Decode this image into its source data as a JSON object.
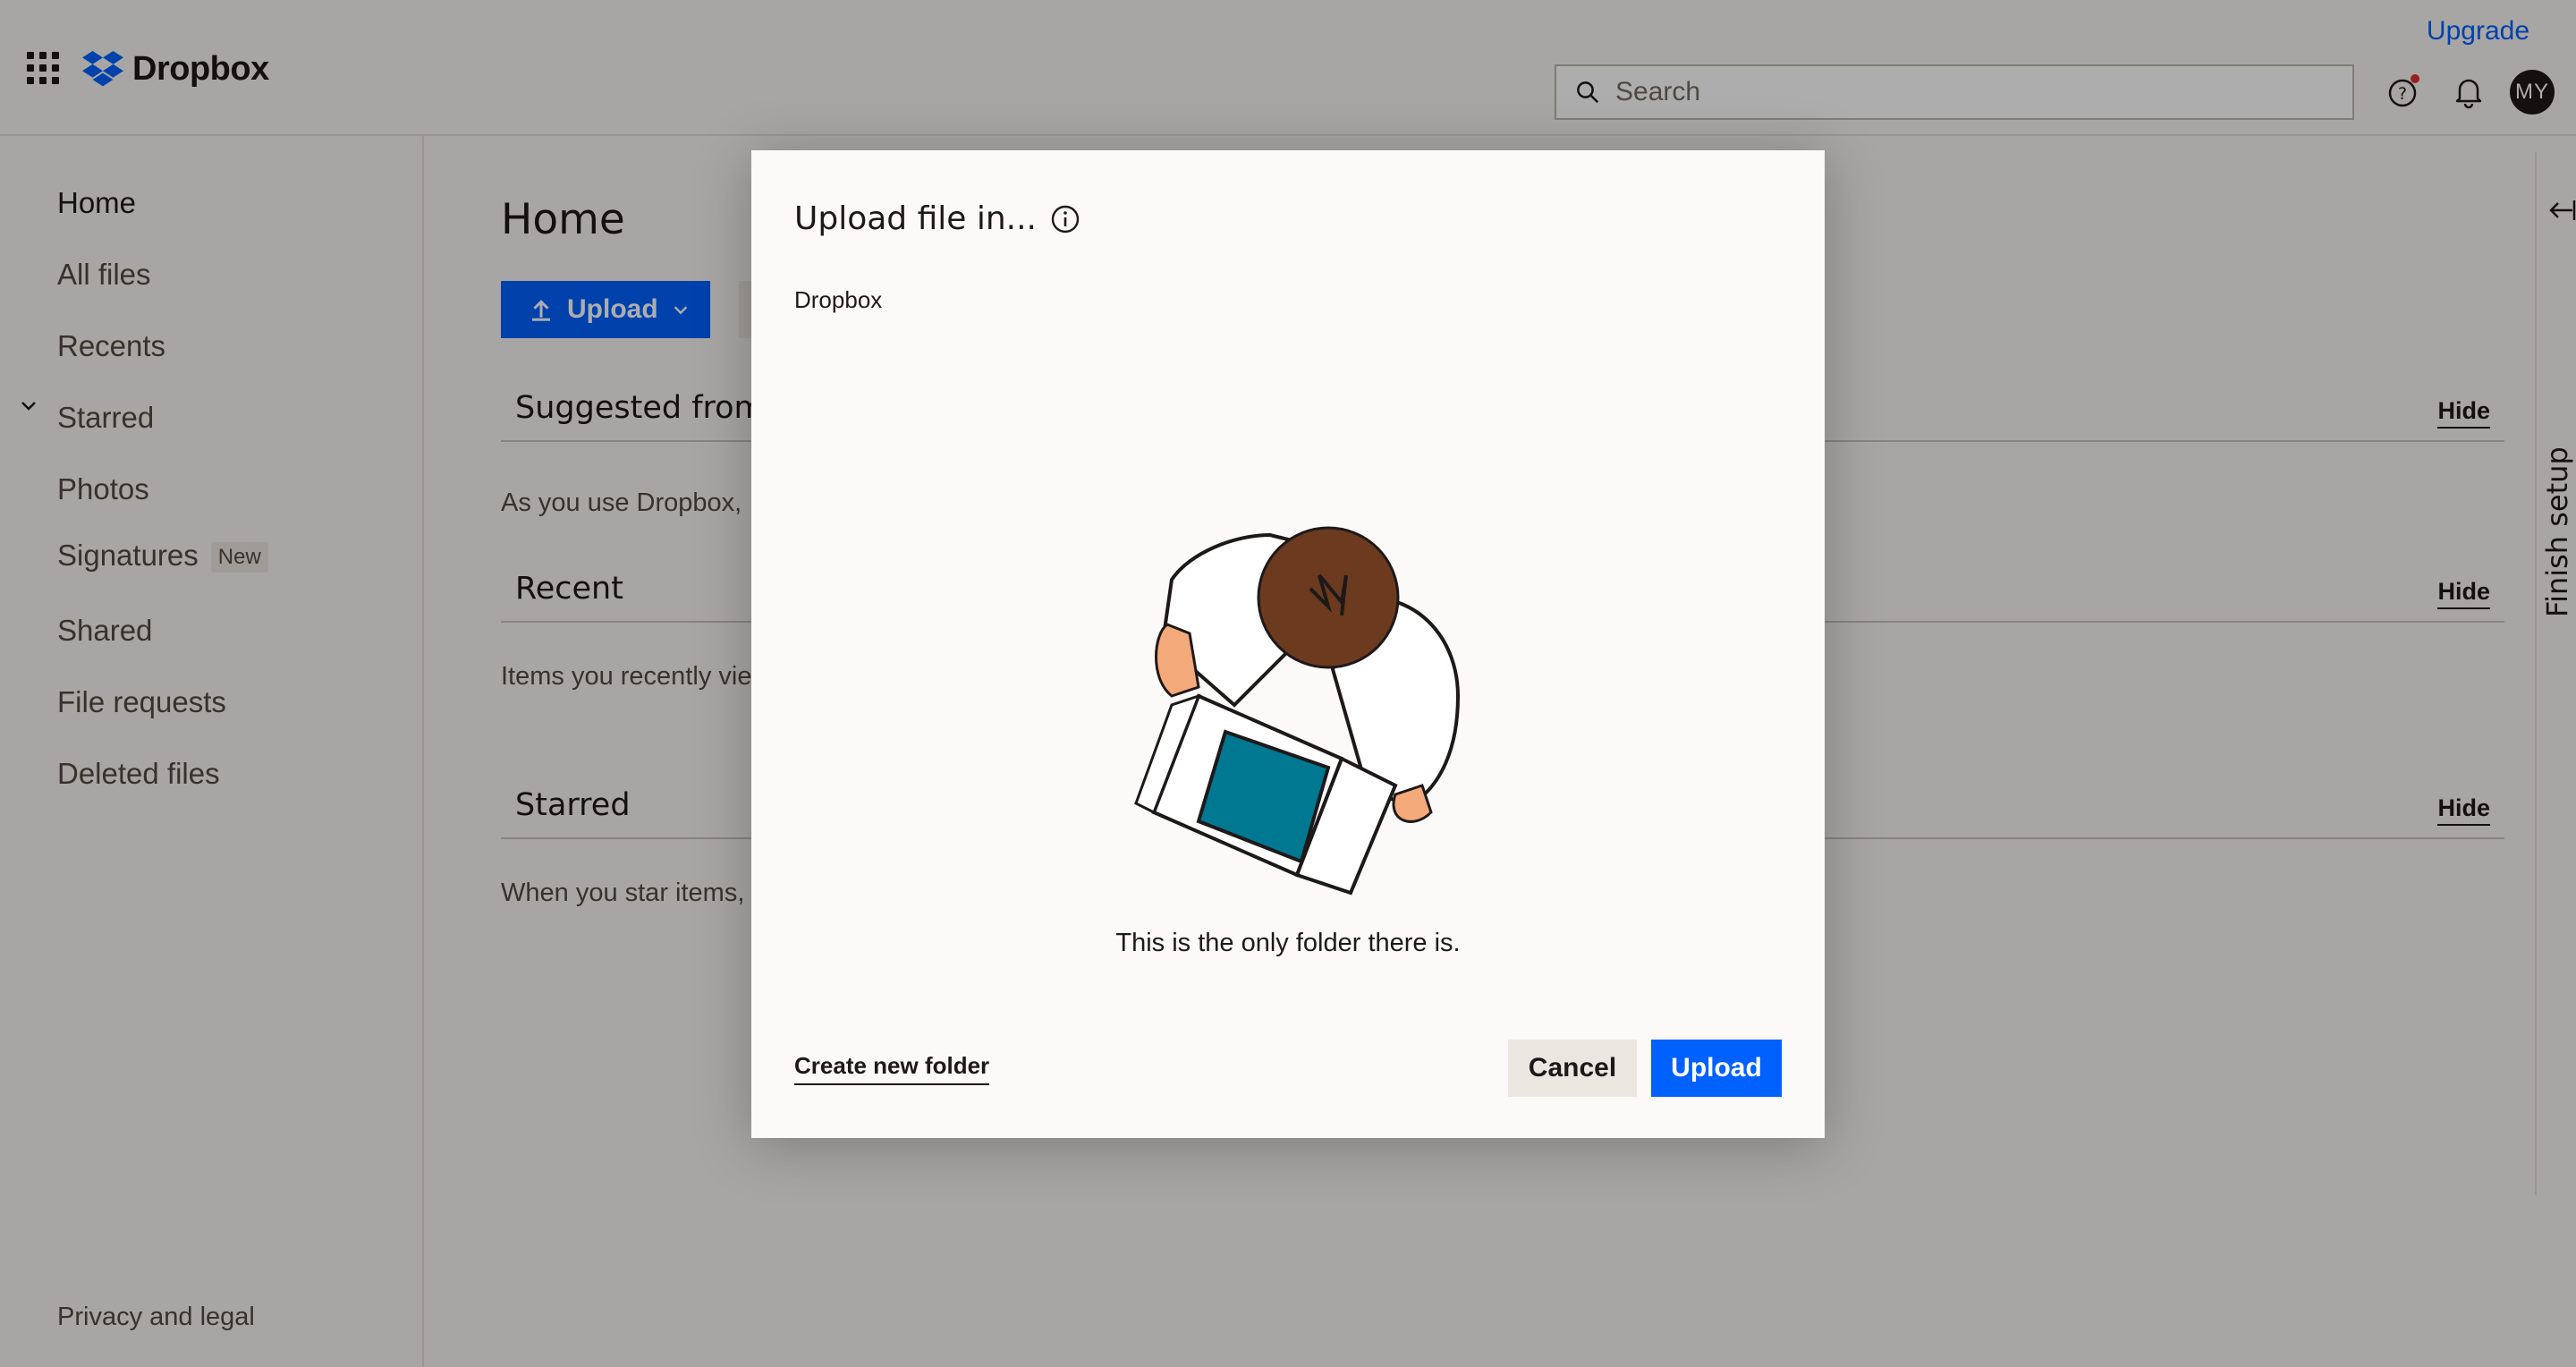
{
  "header": {
    "brand": "Dropbox",
    "upgrade_label": "Upgrade",
    "search_placeholder": "Search",
    "avatar_initials": "MY"
  },
  "sidebar": {
    "items": [
      {
        "label": "Home"
      },
      {
        "label": "All files"
      },
      {
        "label": "Recents"
      },
      {
        "label": "Starred"
      },
      {
        "label": "Photos"
      },
      {
        "label": "Signatures",
        "badge": "New"
      },
      {
        "label": "Shared"
      },
      {
        "label": "File requests"
      },
      {
        "label": "Deleted files"
      }
    ],
    "footer_link": "Privacy and legal"
  },
  "main": {
    "title": "Home",
    "upload_label": "Upload",
    "sections": [
      {
        "title": "Suggested from",
        "text": "As you use Dropbox,",
        "hide_label": "Hide"
      },
      {
        "title": "Recent",
        "text": "Items you recently vie",
        "hide_label": "Hide"
      },
      {
        "title": "Starred",
        "text": "When you star items,",
        "hide_label": "Hide"
      }
    ]
  },
  "right_rail": {
    "label": "Finish setup"
  },
  "modal": {
    "title": "Upload file in...",
    "path": "Dropbox",
    "empty_message": "This is the only folder there is.",
    "create_folder_label": "Create new folder",
    "cancel_label": "Cancel",
    "upload_label": "Upload"
  },
  "colors": {
    "accent": "#0061fe",
    "text": "#1e1919",
    "background": "#f7f5f2",
    "illustration_box": "#007891",
    "illustration_hair": "#6b3a1f"
  },
  "icons": [
    "apps-grid-icon",
    "dropbox-logo-icon",
    "search-icon",
    "help-icon",
    "bell-icon",
    "upload-arrow-icon",
    "chevron-down-icon",
    "collapse-arrow-icon",
    "info-icon"
  ]
}
